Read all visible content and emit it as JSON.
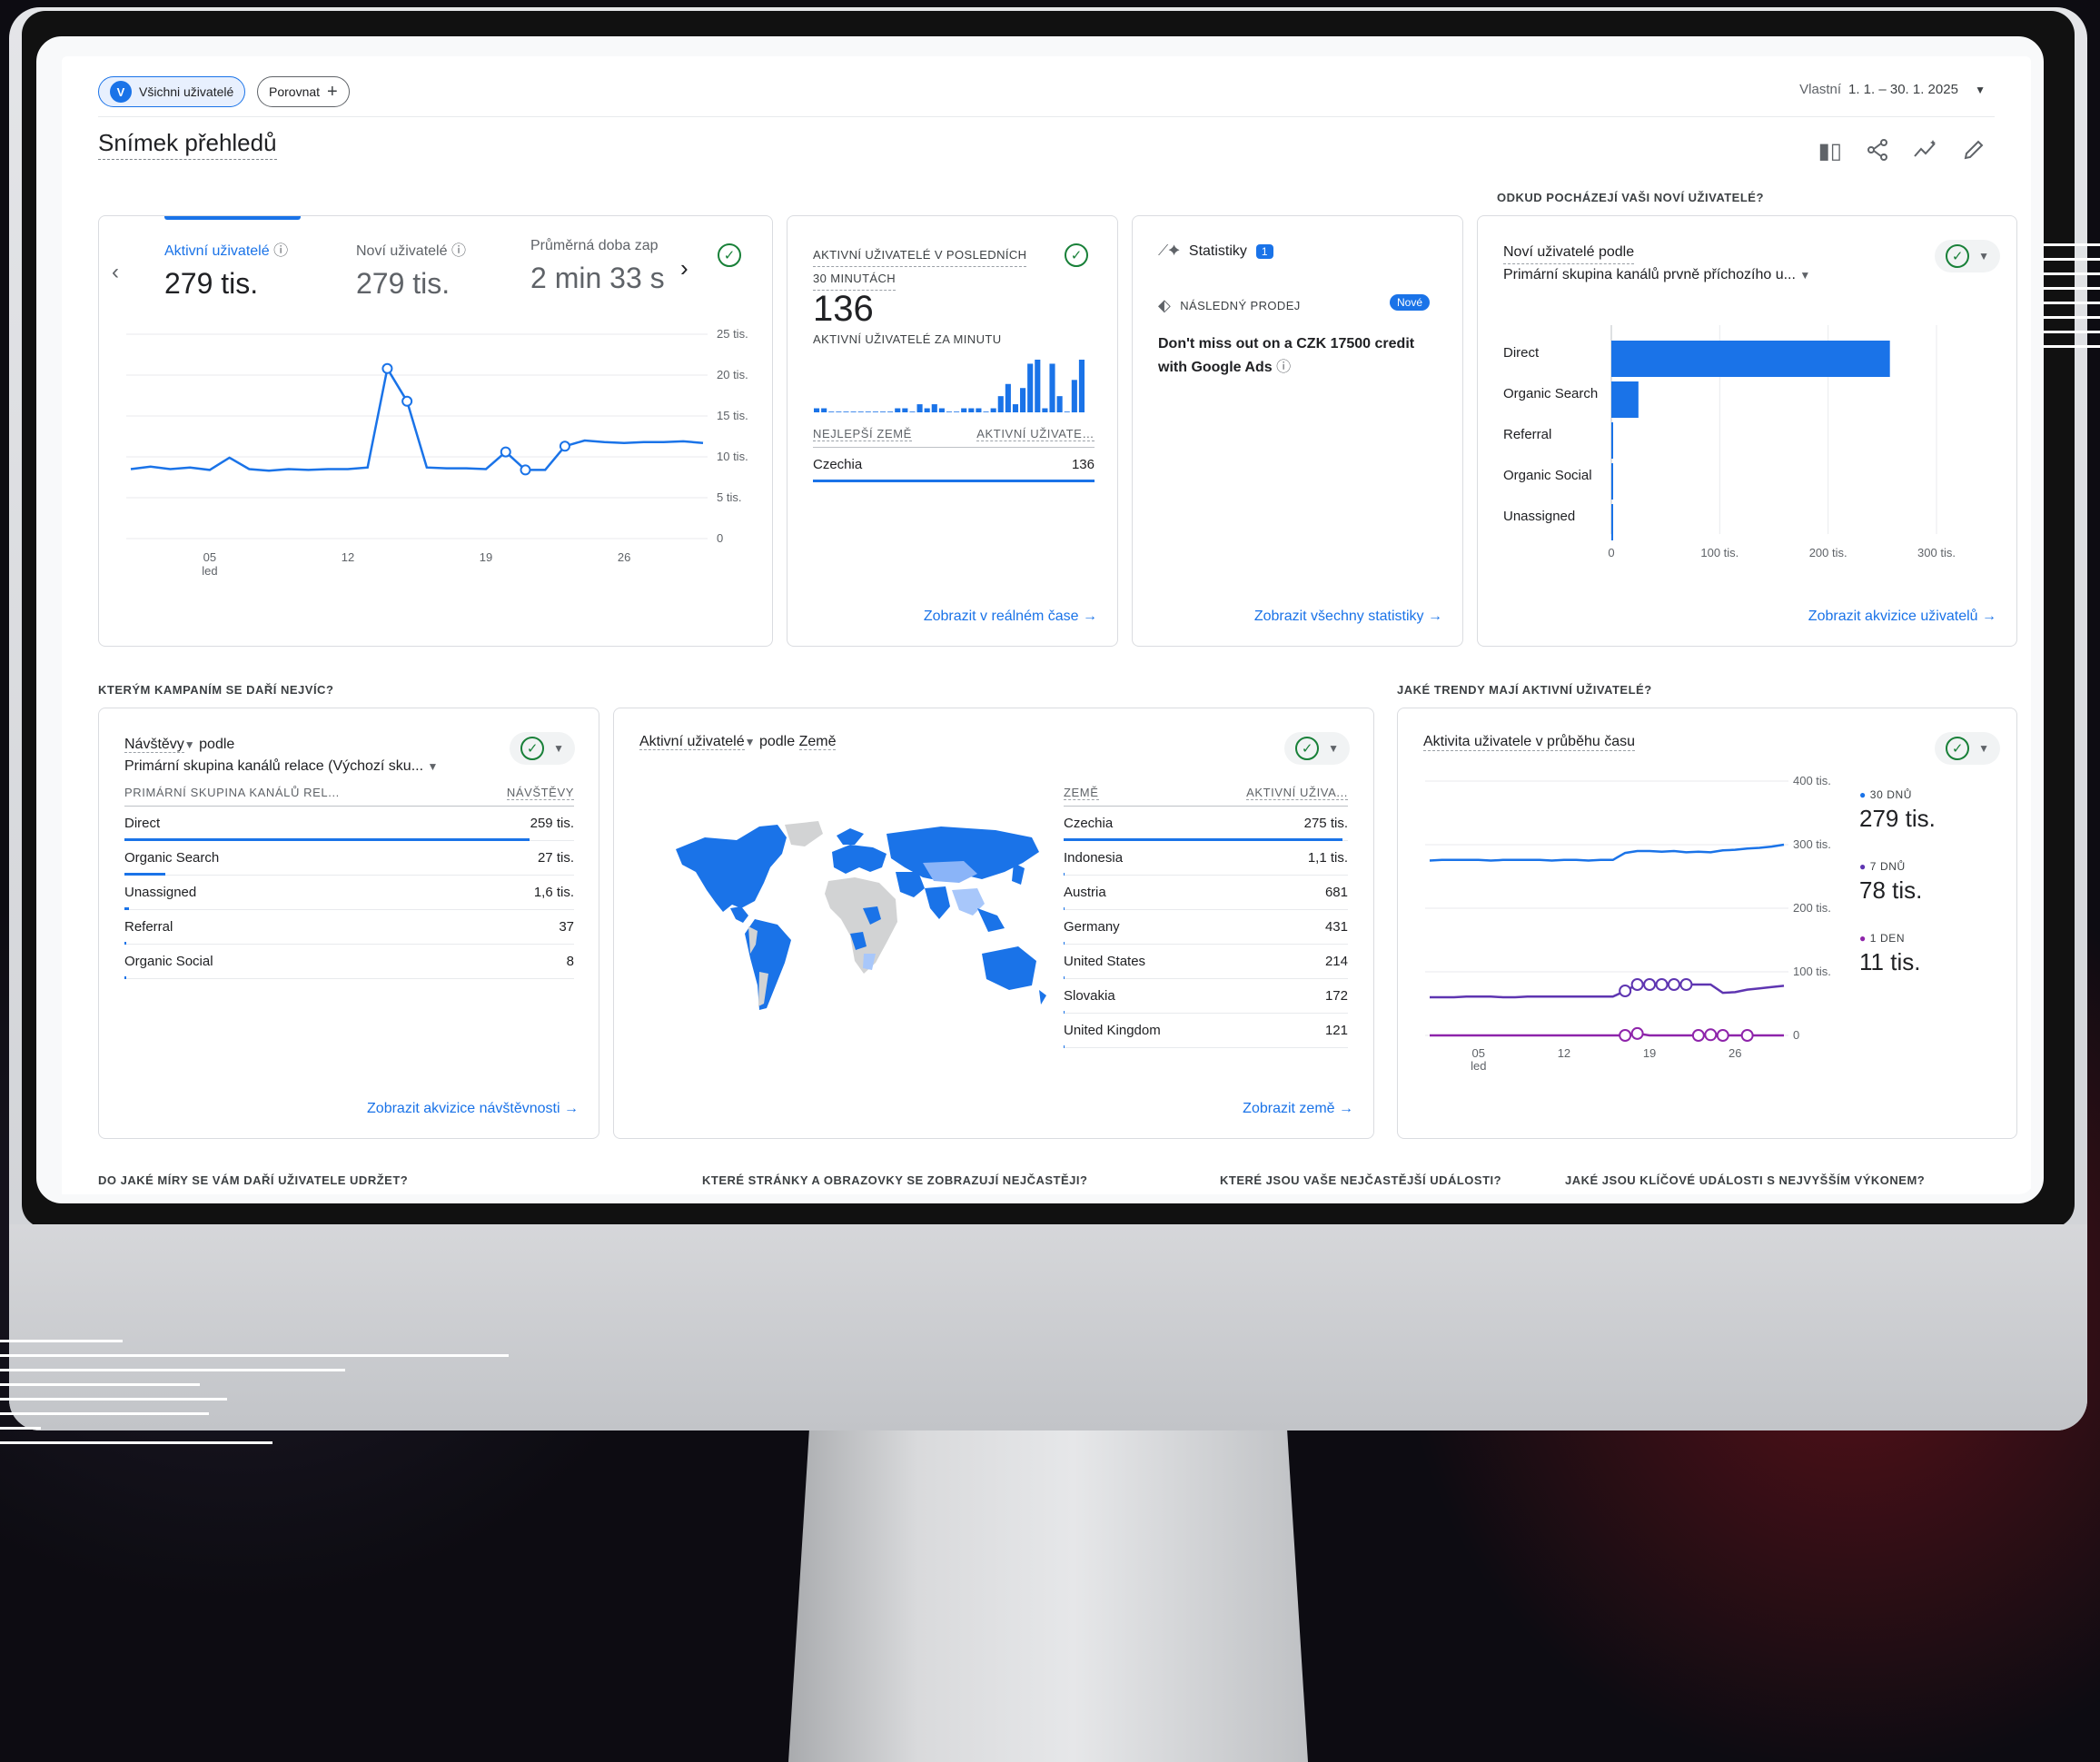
{
  "segment_chip": {
    "letter": "V",
    "label": "Všichni uživatelé"
  },
  "compare_chip": {
    "label": "Porovnat",
    "icon": "plus-icon"
  },
  "date_range": {
    "mode": "Vlastní",
    "value": "1. 1. – 30. 1. 2025"
  },
  "page_title": "Snímek přehledů",
  "toolbar_icons": [
    "compare-columns-icon",
    "share-icon",
    "insights-icon",
    "edit-icon"
  ],
  "sections": {
    "new_users_origin": "ODKUD POCHÁZEJÍ VAŠI NOVÍ UŽIVATELÉ?",
    "campaigns": "KTERÝM KAMPANÍM SE DAŘÍ NEJVÍC?",
    "trends": "JAKÉ TRENDY MAJÍ AKTIVNÍ UŽIVATELÉ?",
    "retention": "DO JAKÉ MÍRY SE VÁM DAŘÍ UŽIVATELE UDRŽET?",
    "pages": "KTERÉ STRÁNKY A OBRAZOVKY SE ZOBRAZUJÍ NEJČASTĚJI?",
    "events": "KTERÉ JSOU VAŠE NEJČASTĚJŠÍ UDÁLOSTI?",
    "key_events": "JAKÉ JSOU KLÍČOVÉ UDÁLOSTI S NEJVYŠŠÍM VÝKONEM?"
  },
  "overview_card": {
    "metrics": [
      {
        "label": "Aktivní uživatelé",
        "value": "279 tis."
      },
      {
        "label": "Noví uživatelé",
        "value": "279 tis."
      },
      {
        "label": "Průměrná doba zap",
        "value": "2 min 33 s"
      }
    ]
  },
  "realtime_card": {
    "heading_line1": "AKTIVNÍ UŽIVATELÉ V POSLEDNÍCH",
    "heading_line2": "30 MINUTÁCH",
    "value": "136",
    "sub": "AKTIVNÍ UŽIVATELÉ ZA MINUTU",
    "col1": "NEJLEPŠÍ ZEMĚ",
    "col2": "AKTIVNÍ UŽIVATE…",
    "row": {
      "country": "Czechia",
      "value": "136"
    },
    "link": "Zobrazit v reálném čase"
  },
  "insights_card": {
    "title": "Statistiky",
    "badge": "1",
    "tag": "NÁSLEDNÝ PRODEJ",
    "new_badge": "Nové",
    "text_line1": "Don't miss out on a CZK 17500 credit",
    "text_line2": "with Google Ads",
    "link": "Zobrazit všechny statistiky"
  },
  "acquisition_card": {
    "title": "Noví uživatelé podle",
    "subtitle": "Primární skupina kanálů prvně příchozího u...",
    "link": "Zobrazit akvizice uživatelů"
  },
  "campaign_card": {
    "title": "Návštěvy",
    "title_suffix": "podle",
    "subtitle": "Primární skupina kanálů relace (Výchozí sku...",
    "col1": "PRIMÁRNÍ SKUPINA KANÁLŮ REL...",
    "col2": "NÁVŠTĚVY",
    "rows": [
      {
        "name": "Direct",
        "value": "259 tis.",
        "share": 0.9
      },
      {
        "name": "Organic Search",
        "value": "27 tis.",
        "share": 0.09
      },
      {
        "name": "Unassigned",
        "value": "1,6 tis.",
        "share": 0.01
      },
      {
        "name": "Referral",
        "value": "37",
        "share": 0.002
      },
      {
        "name": "Organic Social",
        "value": "8",
        "share": 0.001
      }
    ],
    "link": "Zobrazit akvizice návštěvnosti"
  },
  "country_card": {
    "title": "Aktivní uživatelé",
    "title_mid": "podle",
    "title_dim": "Země",
    "col1": "ZEMĚ",
    "col2": "AKTIVNÍ UŽIVA...",
    "rows": [
      {
        "name": "Czechia",
        "value": "275 tis.",
        "share": 0.98
      },
      {
        "name": "Indonesia",
        "value": "1,1 tis.",
        "share": 0.004
      },
      {
        "name": "Austria",
        "value": "681",
        "share": 0.003
      },
      {
        "name": "Germany",
        "value": "431",
        "share": 0.002
      },
      {
        "name": "United States",
        "value": "214",
        "share": 0.001
      },
      {
        "name": "Slovakia",
        "value": "172",
        "share": 0.001
      },
      {
        "name": "United Kingdom",
        "value": "121",
        "share": 0.001
      }
    ],
    "link": "Zobrazit země"
  },
  "trend_card": {
    "title": "Aktivita uživatele v průběhu času",
    "legend": [
      {
        "label": "30 DNŮ",
        "value": "279 tis.",
        "color": "#1a73e8"
      },
      {
        "label": "7 DNŮ",
        "value": "78 tis.",
        "color": "#5e35b1"
      },
      {
        "label": "1 DEN",
        "value": "11 tis.",
        "color": "#8e24aa"
      }
    ]
  },
  "chart_data": [
    {
      "type": "line",
      "title": "Aktivní uživatelé",
      "x_ticks": [
        "05 led",
        "12",
        "19",
        "26"
      ],
      "y_ticks": [
        "0",
        "5 tis.",
        "10 tis.",
        "15 tis.",
        "20 tis.",
        "25 tis."
      ],
      "ylim": [
        0,
        25000
      ],
      "x": [
        1,
        2,
        3,
        4,
        5,
        6,
        7,
        8,
        9,
        10,
        11,
        12,
        13,
        14,
        15,
        16,
        17,
        18,
        19,
        20,
        21,
        22,
        23,
        24,
        25,
        26,
        27,
        28,
        29,
        30
      ],
      "series": [
        {
          "name": "Aktivní uživatelé",
          "color": "#1a73e8",
          "values": [
            8500,
            8800,
            8500,
            8700,
            8400,
            9900,
            8500,
            8300,
            8500,
            8400,
            8500,
            8500,
            8700,
            20800,
            16800,
            8700,
            8600,
            8600,
            8500,
            10600,
            8400,
            8400,
            11300,
            12000,
            11800,
            11700,
            11800,
            11800,
            11900,
            11700
          ]
        }
      ]
    },
    {
      "type": "bar",
      "title": "AKTIVNÍ UŽIVATELÉ ZA MINUTU",
      "values": [
        1,
        1,
        0,
        0,
        0,
        0,
        0,
        0,
        0,
        0,
        0,
        1,
        1,
        0,
        2,
        1,
        2,
        1,
        0,
        0,
        1,
        1,
        1,
        0,
        1,
        4,
        7,
        2,
        6,
        12,
        13,
        1,
        12,
        4,
        0,
        8,
        13
      ]
    },
    {
      "type": "bar",
      "orientation": "horizontal",
      "title": "Noví uživatelé podle",
      "categories": [
        "Direct",
        "Organic Search",
        "Referral",
        "Organic Social",
        "Unassigned"
      ],
      "values": [
        257000,
        25000,
        400,
        150,
        100
      ],
      "x_ticks": [
        "0",
        "100 tis.",
        "200 tis.",
        "300 tis."
      ],
      "xlim": [
        0,
        300000
      ]
    },
    {
      "type": "line",
      "title": "Aktivita uživatele v průběhu času",
      "x_ticks": [
        "05 led",
        "12",
        "19",
        "26"
      ],
      "y_ticks": [
        "0",
        "100 tis.",
        "200 tis.",
        "300 tis.",
        "400 tis."
      ],
      "ylim": [
        0,
        400000
      ],
      "series": [
        {
          "name": "30 DNŮ",
          "color": "#1a73e8",
          "values": [
            275000,
            276000,
            276000,
            276000,
            276000,
            275000,
            276000,
            276000,
            276000,
            276000,
            275000,
            276000,
            276000,
            275000,
            276000,
            276000,
            287000,
            290000,
            290000,
            289000,
            290000,
            288000,
            289000,
            288000,
            291000,
            292000,
            294000,
            295000,
            297000,
            300000
          ]
        },
        {
          "name": "7 DNŮ",
          "color": "#5e35b1",
          "values": [
            60000,
            60000,
            60000,
            61000,
            61000,
            61000,
            60000,
            60000,
            61000,
            61000,
            61000,
            61000,
            61000,
            61000,
            61000,
            61000,
            70000,
            80000,
            80000,
            80000,
            80000,
            80000,
            80000,
            80000,
            67000,
            68000,
            72000,
            74000,
            76000,
            78000
          ]
        },
        {
          "name": "1 DEN",
          "color": "#8e24aa",
          "values": [
            0,
            0,
            0,
            0,
            0,
            0,
            0,
            0,
            0,
            0,
            0,
            0,
            0,
            0,
            0,
            0,
            0,
            3000,
            0,
            0,
            0,
            0,
            0,
            1000,
            0,
            0,
            0,
            0,
            0,
            0
          ]
        }
      ]
    }
  ]
}
